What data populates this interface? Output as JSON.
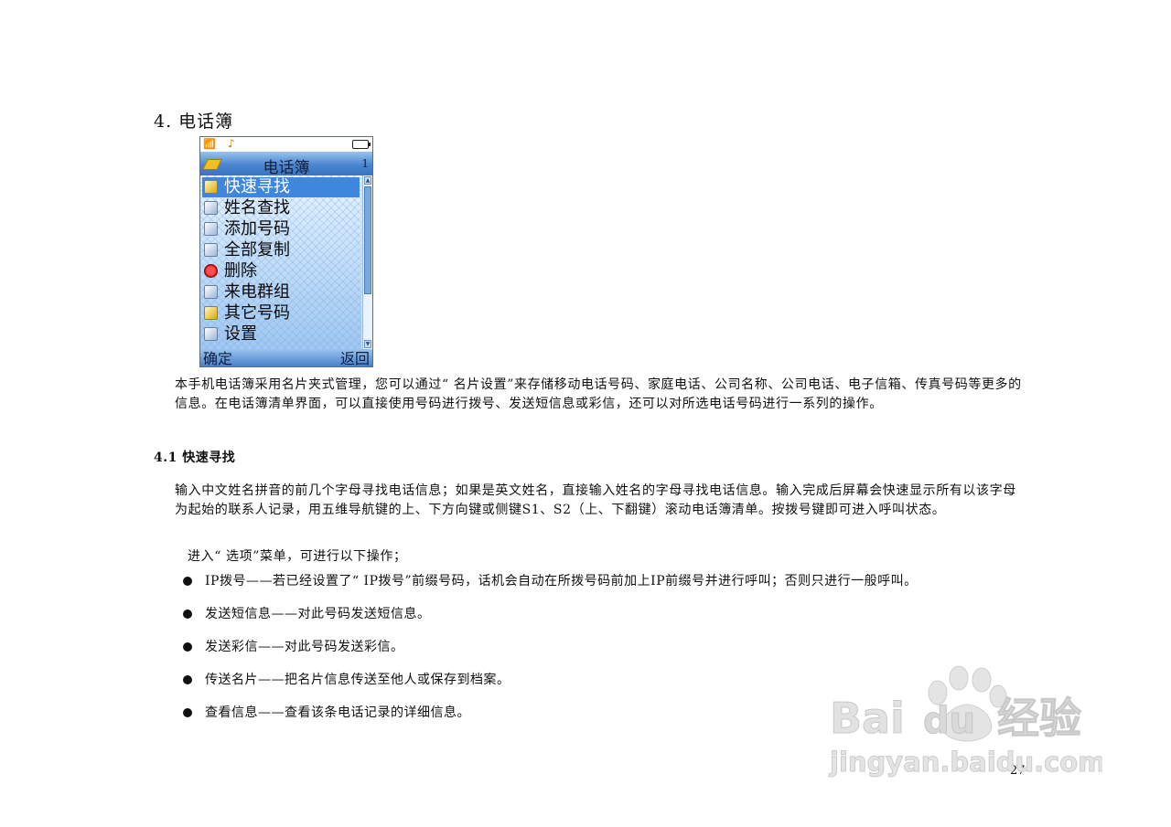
{
  "heading": "4. 电话簿",
  "phone": {
    "title": "电话簿",
    "page_indicator": "1",
    "menu_items": [
      {
        "label": "快速寻找",
        "icon": "search-person-icon",
        "selected": true
      },
      {
        "label": "姓名查找",
        "icon": "magnifier-icon",
        "selected": false
      },
      {
        "label": "添加号码",
        "icon": "add-contact-icon",
        "selected": false
      },
      {
        "label": "全部复制",
        "icon": "copy-icon",
        "selected": false
      },
      {
        "label": "删除",
        "icon": "delete-icon",
        "selected": false
      },
      {
        "label": "来电群组",
        "icon": "group-icon",
        "selected": false
      },
      {
        "label": "其它号码",
        "icon": "card-icon",
        "selected": false
      },
      {
        "label": "设置",
        "icon": "settings-icon",
        "selected": false
      }
    ],
    "softkey_left": "确定",
    "softkey_right": "返回"
  },
  "intro_paragraph": "本手机电话簿采用名片夹式管理，您可以通过“ 名片设置”来存储移动电话号码、家庭电话、公司名称、公司电话、电子信箱、传真号码等更多的信息。在电话簿清单界面，可以直接使用号码进行拨号、发送短信息或彩信，还可以对所选电话号码进行一系列的操作。",
  "section_title": "4.1 快速寻找",
  "section_paragraph": "输入中文姓名拼音的前几个字母寻找电话信息；如果是英文姓名，直接输入姓名的字母寻找电话信息。输入完成后屏幕会快速显示所有以该字母为起始的联系人记录，用五维导航键的上、下方向键或侧键S1、S2（上、下翻键）滚动电话簿清单。按拨号键即可进入呼叫状态。",
  "options_intro": "进入“ 选项”菜单，可进行以下操作；",
  "bullets": [
    "IP拨号——若已经设置了“ IP拨号”前缀号码，话机会自动在所拨号码前加上IP前缀号并进行呼叫；否则只进行一般呼叫。",
    "发送短信息——对此号码发送短信息。",
    "发送彩信——对此号码发送彩信。",
    "传送名片——把名片信息传送至他人或保存到档案。",
    "查看信息——查看该条电话记录的详细信息。"
  ],
  "page_number": "27",
  "watermark": {
    "brand": "Bai",
    "brand_mid": "du",
    "brand_cn": "经验",
    "url": "jingyan.baidu.com"
  }
}
